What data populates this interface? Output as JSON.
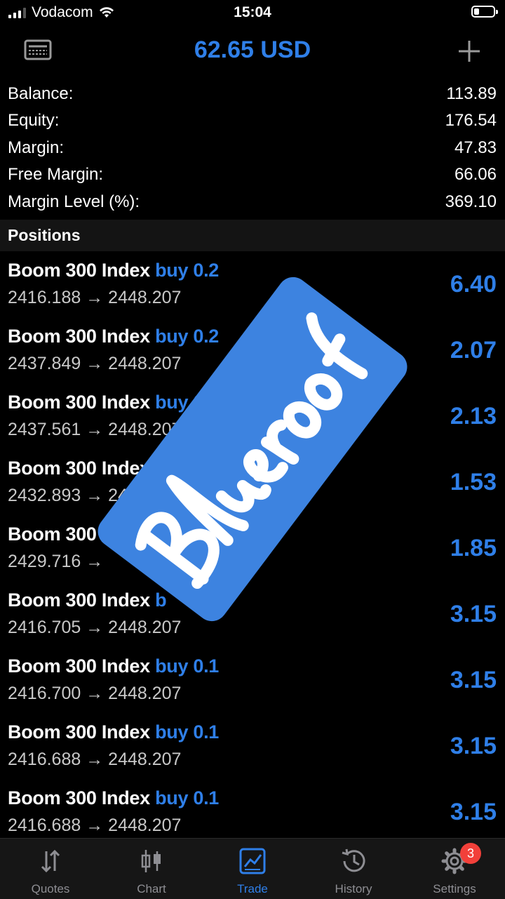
{
  "status_bar": {
    "carrier": "Vodacom",
    "time": "15:04",
    "battery_level": 0.25
  },
  "header": {
    "title": "62.65 USD",
    "left_icon": "card-icon",
    "right_icon": "plus-icon"
  },
  "summary": [
    {
      "label": "Balance:",
      "value": "113.89"
    },
    {
      "label": "Equity:",
      "value": "176.54"
    },
    {
      "label": "Margin:",
      "value": "47.83"
    },
    {
      "label": "Free Margin:",
      "value": "66.06"
    },
    {
      "label": "Margin Level (%):",
      "value": "369.10"
    }
  ],
  "section_title": "Positions",
  "positions": [
    {
      "symbol": "Boom 300 Index",
      "type": "buy 0.2",
      "prices": "2416.188 → 2448.207",
      "profit": "6.40"
    },
    {
      "symbol": "Boom 300 Index",
      "type": "buy 0.2",
      "prices": "2437.849 → 2448.207",
      "profit": "2.07"
    },
    {
      "symbol": "Boom 300 Index",
      "type": "buy 0.2",
      "prices": "2437.561 → 2448.207",
      "profit": "2.13"
    },
    {
      "symbol": "Boom 300 Index",
      "type": "buy 0",
      "prices": "2432.893 → 2448",
      "profit": "1.53"
    },
    {
      "symbol": "Boom 300 Index",
      "type": "",
      "prices": "2429.716 →",
      "profit": "1.85"
    },
    {
      "symbol": "Boom 300 Index",
      "type": "b",
      "prices": "2416.705 → 2448.207",
      "profit": "3.15"
    },
    {
      "symbol": "Boom 300 Index",
      "type": "buy 0.1",
      "prices": "2416.700 → 2448.207",
      "profit": "3.15"
    },
    {
      "symbol": "Boom 300 Index",
      "type": "buy 0.1",
      "prices": "2416.688 → 2448.207",
      "profit": "3.15"
    },
    {
      "symbol": "Boom 300 Index",
      "type": "buy 0.1",
      "prices": "2416.688 → 2448.207",
      "profit": "3.15"
    }
  ],
  "watermark": {
    "text": "Blueroof",
    "color": "#3d83e0"
  },
  "tabs": [
    {
      "label": "Quotes",
      "icon": "quotes-arrows-icon"
    },
    {
      "label": "Chart",
      "icon": "candlestick-icon"
    },
    {
      "label": "Trade",
      "icon": "trade-chart-icon"
    },
    {
      "label": "History",
      "icon": "history-clock-icon"
    },
    {
      "label": "Settings",
      "icon": "gear-icon",
      "badge": "3"
    }
  ],
  "active_tab": "Trade",
  "colors": {
    "accent": "#2f7fe8",
    "background": "#000000",
    "badge": "#f2403a"
  }
}
